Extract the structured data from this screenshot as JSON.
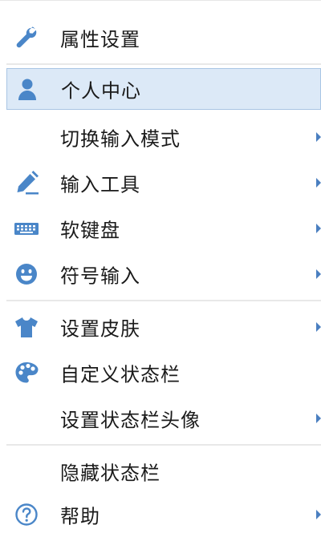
{
  "accent_color": "#4a86c8",
  "highlight_color": "#dce9f7",
  "menu": {
    "items": [
      {
        "label": "属性设置",
        "icon": "wrench-icon",
        "submenu": false
      },
      {
        "label": "个人中心",
        "icon": "user-icon",
        "submenu": false,
        "highlighted": true
      },
      {
        "label": "切换输入模式",
        "icon": "",
        "submenu": true
      },
      {
        "label": "输入工具",
        "icon": "pencil-icon",
        "submenu": true
      },
      {
        "label": "软键盘",
        "icon": "keyboard-icon",
        "submenu": true
      },
      {
        "label": "符号输入",
        "icon": "smiley-icon",
        "submenu": true
      },
      {
        "label": "设置皮肤",
        "icon": "shirt-icon",
        "submenu": true
      },
      {
        "label": "自定义状态栏",
        "icon": "palette-icon",
        "submenu": false
      },
      {
        "label": "设置状态栏头像",
        "icon": "",
        "submenu": true
      },
      {
        "label": "隐藏状态栏",
        "icon": "",
        "submenu": false
      },
      {
        "label": "帮助",
        "icon": "help-circle-icon",
        "submenu": true
      }
    ]
  }
}
